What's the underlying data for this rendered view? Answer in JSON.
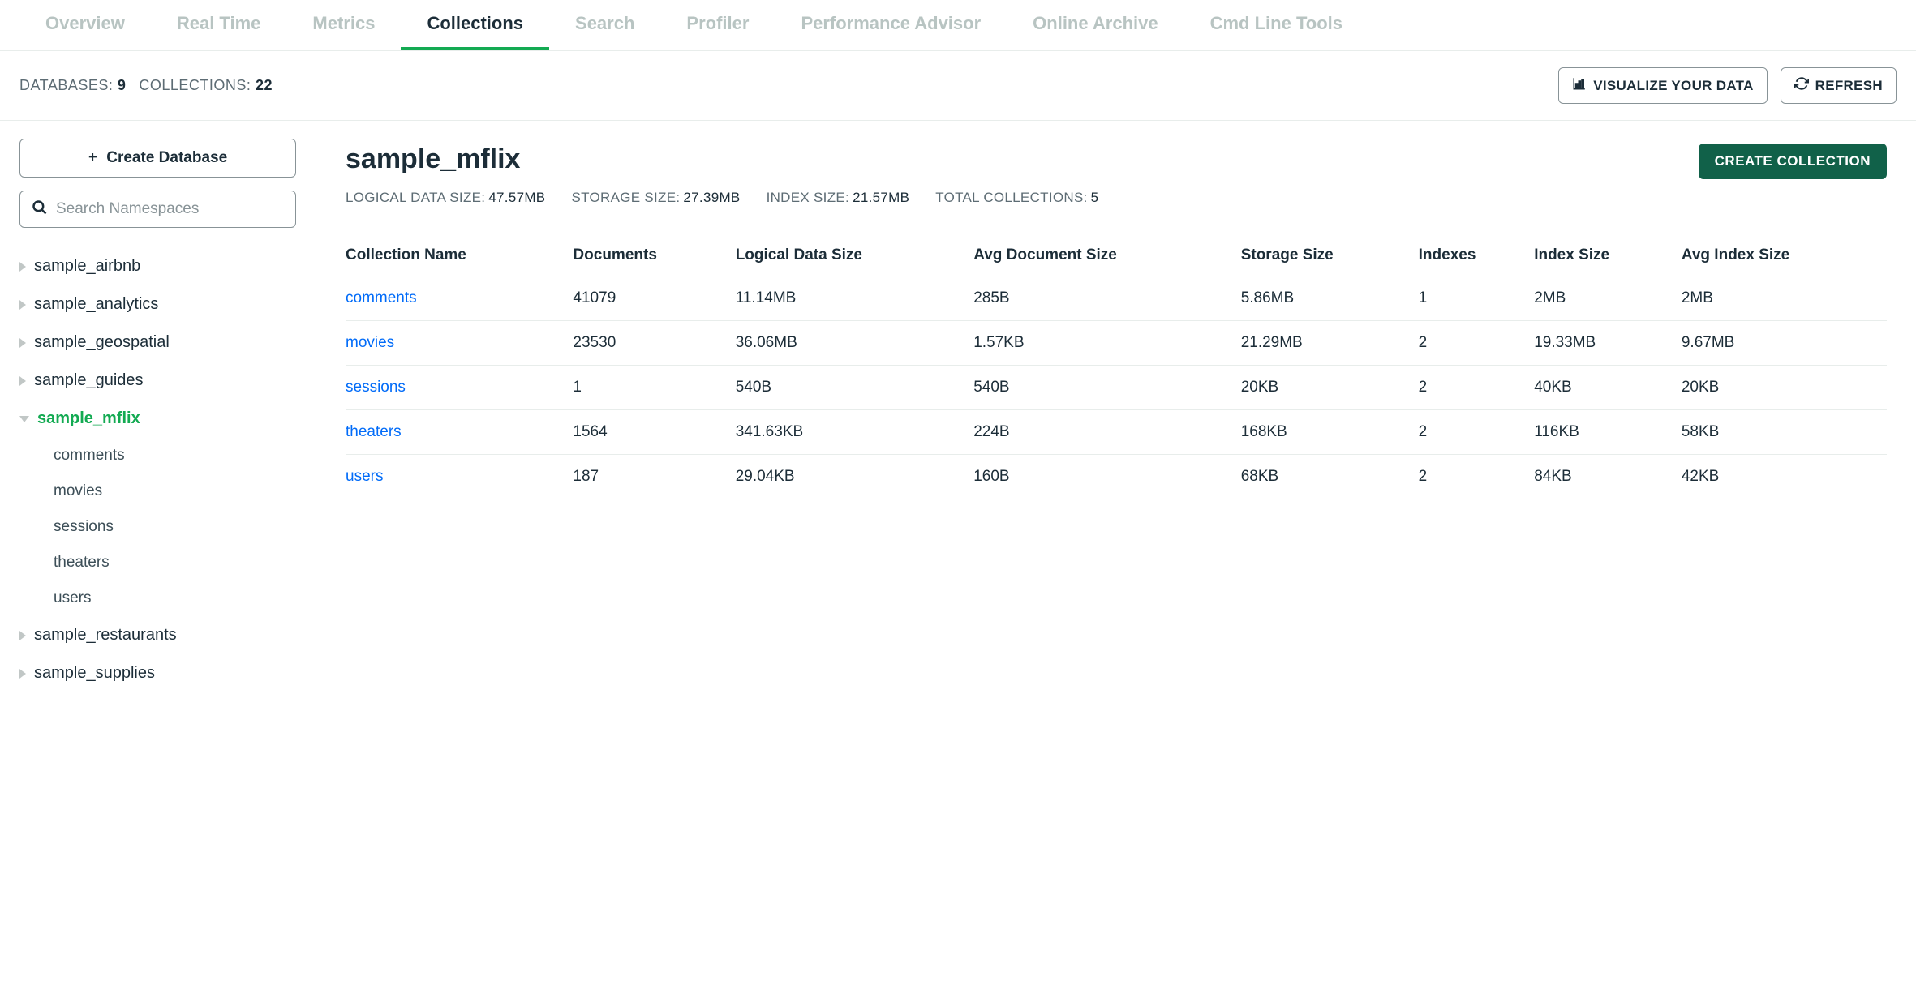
{
  "tabs": [
    {
      "label": "Overview",
      "active": false
    },
    {
      "label": "Real Time",
      "active": false
    },
    {
      "label": "Metrics",
      "active": false
    },
    {
      "label": "Collections",
      "active": true
    },
    {
      "label": "Search",
      "active": false
    },
    {
      "label": "Profiler",
      "active": false
    },
    {
      "label": "Performance Advisor",
      "active": false
    },
    {
      "label": "Online Archive",
      "active": false
    },
    {
      "label": "Cmd Line Tools",
      "active": false
    }
  ],
  "summary": {
    "databases_label": "DATABASES:",
    "databases_value": "9",
    "collections_label": "COLLECTIONS:",
    "collections_value": "22"
  },
  "actions": {
    "visualize": "VISUALIZE YOUR DATA",
    "refresh": "REFRESH",
    "create_db": "Create Database",
    "create_collection": "CREATE COLLECTION"
  },
  "search": {
    "placeholder": "Search Namespaces"
  },
  "sidebar": {
    "databases": [
      {
        "name": "sample_airbnb",
        "expanded": false,
        "collections": []
      },
      {
        "name": "sample_analytics",
        "expanded": false,
        "collections": []
      },
      {
        "name": "sample_geospatial",
        "expanded": false,
        "collections": []
      },
      {
        "name": "sample_guides",
        "expanded": false,
        "collections": []
      },
      {
        "name": "sample_mflix",
        "expanded": true,
        "collections": [
          "comments",
          "movies",
          "sessions",
          "theaters",
          "users"
        ]
      },
      {
        "name": "sample_restaurants",
        "expanded": false,
        "collections": []
      },
      {
        "name": "sample_supplies",
        "expanded": false,
        "collections": []
      }
    ]
  },
  "main": {
    "title": "sample_mflix",
    "stats": [
      {
        "label": "LOGICAL DATA SIZE:",
        "value": "47.57MB"
      },
      {
        "label": "STORAGE SIZE:",
        "value": "27.39MB"
      },
      {
        "label": "INDEX SIZE:",
        "value": "21.57MB"
      },
      {
        "label": "TOTAL COLLECTIONS:",
        "value": "5"
      }
    ],
    "headers": [
      "Collection Name",
      "Documents",
      "Logical Data Size",
      "Avg Document Size",
      "Storage Size",
      "Indexes",
      "Index Size",
      "Avg Index Size"
    ],
    "rows": [
      {
        "name": "comments",
        "documents": "41079",
        "logical_data_size": "11.14MB",
        "avg_doc_size": "285B",
        "storage_size": "5.86MB",
        "indexes": "1",
        "index_size": "2MB",
        "avg_index_size": "2MB"
      },
      {
        "name": "movies",
        "documents": "23530",
        "logical_data_size": "36.06MB",
        "avg_doc_size": "1.57KB",
        "storage_size": "21.29MB",
        "indexes": "2",
        "index_size": "19.33MB",
        "avg_index_size": "9.67MB"
      },
      {
        "name": "sessions",
        "documents": "1",
        "logical_data_size": "540B",
        "avg_doc_size": "540B",
        "storage_size": "20KB",
        "indexes": "2",
        "index_size": "40KB",
        "avg_index_size": "20KB"
      },
      {
        "name": "theaters",
        "documents": "1564",
        "logical_data_size": "341.63KB",
        "avg_doc_size": "224B",
        "storage_size": "168KB",
        "indexes": "2",
        "index_size": "116KB",
        "avg_index_size": "58KB"
      },
      {
        "name": "users",
        "documents": "187",
        "logical_data_size": "29.04KB",
        "avg_doc_size": "160B",
        "storage_size": "68KB",
        "indexes": "2",
        "index_size": "84KB",
        "avg_index_size": "42KB"
      }
    ]
  }
}
